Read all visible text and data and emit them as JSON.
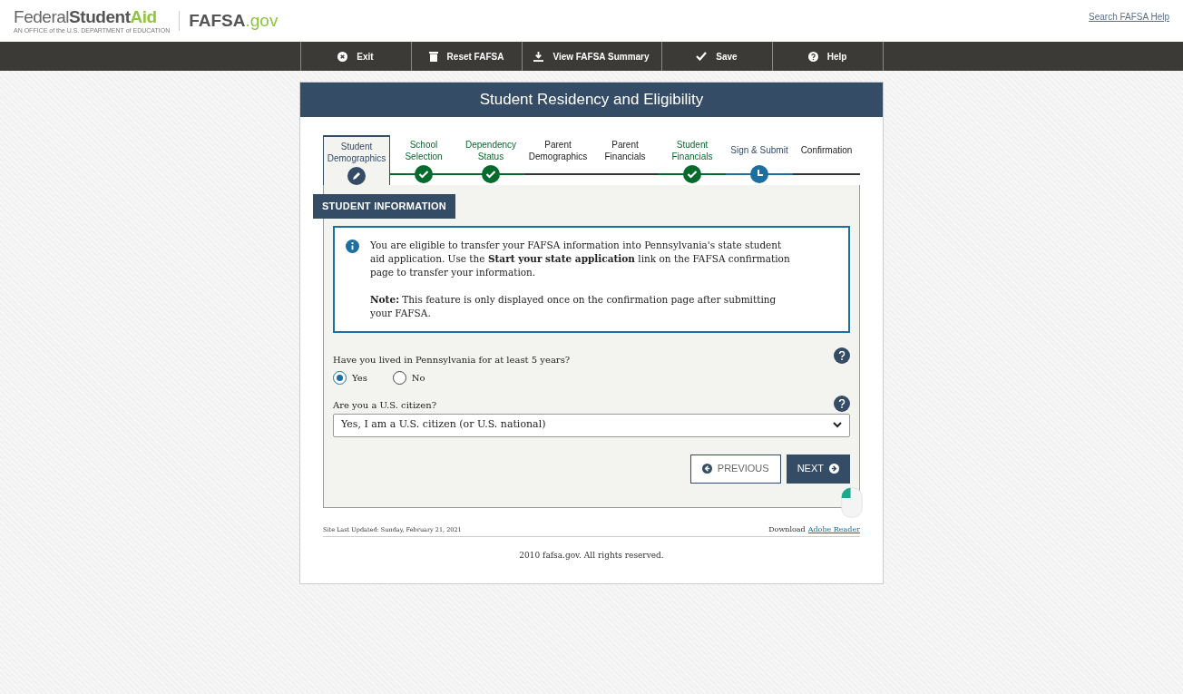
{
  "header": {
    "brand_main": "Federal",
    "brand_bold": "Student",
    "brand_accent": "Aid",
    "brand_tagline": "AN OFFICE of the U.S. DEPARTMENT of EDUCATION",
    "site_name": "FAFSA",
    "site_suffix": ".gov",
    "help_link": "Search FAFSA Help"
  },
  "toolbar": [
    {
      "label": "Exit",
      "kind": "exit"
    },
    {
      "label": "Reset FAFSA",
      "kind": "trash"
    },
    {
      "label": "View FAFSA Summary",
      "kind": "download"
    },
    {
      "label": "Save",
      "kind": "check"
    },
    {
      "label": "Help",
      "kind": "help"
    }
  ],
  "page_title": "Student Residency and Eligibility",
  "steps": [
    {
      "label": "Student Demographics",
      "kind": "current"
    },
    {
      "label": "School Selection",
      "kind": "complete"
    },
    {
      "label": "Dependency Status",
      "kind": "complete"
    },
    {
      "label": "Parent Demographics",
      "kind": "incomplete"
    },
    {
      "label": "Parent Financials",
      "kind": "incomplete"
    },
    {
      "label": "Student Financials",
      "kind": "complete"
    },
    {
      "label": "Sign & Submit",
      "kind": "pending"
    },
    {
      "label": "Confirmation",
      "kind": "incomplete"
    }
  ],
  "section_title": "STUDENT INFORMATION",
  "notice": {
    "text": "You are eligible to transfer your FAFSA information into Pennsylvania's state student aid application. Use the **Start your state application** link on the FAFSA confirmation page to transfer your information.",
    "note": "**Note:** This feature is only displayed once on the confirmation page after submitting your FAFSA."
  },
  "residency_question": {
    "label": "Have you lived in Pennsylvania for at least 5 years?",
    "options": [
      {
        "label": "Yes",
        "selected": true
      },
      {
        "label": "No",
        "selected": false
      }
    ]
  },
  "citizen_question": {
    "label": "Are you a U.S. citizen?",
    "value": "Yes, I am a U.S. citizen (or U.S. national)"
  },
  "buttons": {
    "previous": "PREVIOUS",
    "next": "NEXT"
  },
  "footer": {
    "updated": "Site Last Updated: Sunday, February 21, 2021",
    "download": "Download",
    "download_link": "Adobe Reader",
    "copyright": "2010 fafsa.gov. All rights reserved."
  }
}
